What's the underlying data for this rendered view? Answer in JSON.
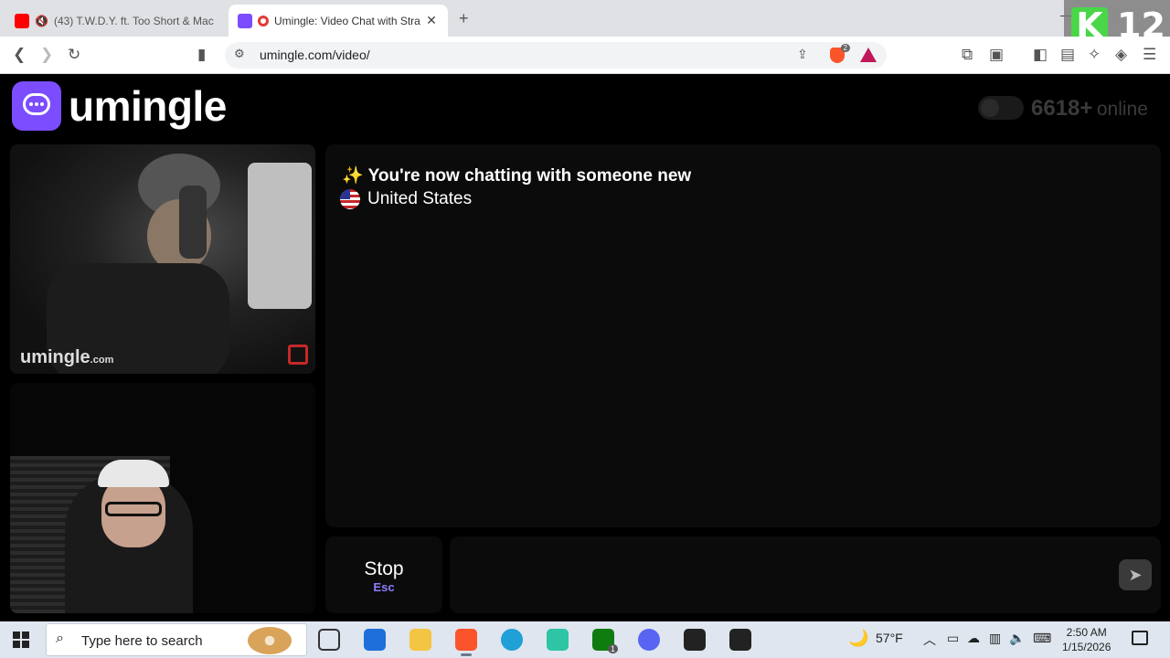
{
  "browser": {
    "tabs": [
      {
        "title": "(43) T.W.D.Y. ft. Too Short & Mac",
        "active": false
      },
      {
        "title": "Umingle: Video Chat with Stra",
        "active": true
      }
    ],
    "new_tab": "+",
    "url": "umingle.com/video/",
    "brave_badge": "2",
    "extension_overlay": {
      "letter": "K",
      "number": "12"
    }
  },
  "site": {
    "logo_text": "umingle",
    "online_count": "6618+",
    "online_word": "online"
  },
  "video": {
    "watermark_main": "umingle",
    "watermark_suffix": ".com"
  },
  "chat": {
    "sparkle": "✨",
    "status_message": "You're now chatting with someone new",
    "country": "United States"
  },
  "controls": {
    "stop_label": "Stop",
    "stop_key": "Esc",
    "send_icon": "➤"
  },
  "taskbar": {
    "search_placeholder": "Type here to search",
    "weather": "57°F",
    "time": "2:50 AM",
    "date": "1/15/2026",
    "xbox_badge": "1"
  }
}
